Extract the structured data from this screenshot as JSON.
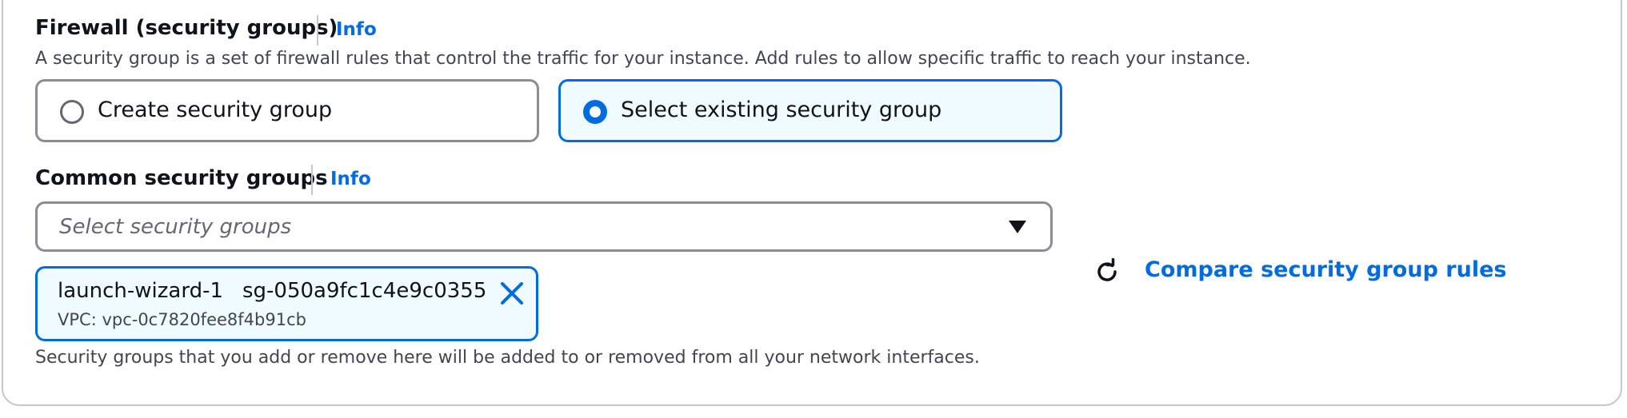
{
  "firewall": {
    "title": "Firewall (security groups)",
    "info_label": "Info",
    "description": "A security group is a set of firewall rules that control the traffic for your instance. Add rules to allow specific traffic to reach your instance.",
    "options": [
      {
        "label": "Create security group",
        "selected": false
      },
      {
        "label": "Select existing security group",
        "selected": true
      }
    ]
  },
  "common_groups": {
    "title": "Common security groups",
    "info_label": "Info",
    "select_placeholder": "Select security groups",
    "selected_token": {
      "name": "launch-wizard-1",
      "id": "sg-050a9fc1c4e9c0355",
      "vpc": "VPC: vpc-0c7820fee8f4b91cb"
    },
    "compare_label": "Compare security group rules",
    "footer_note": "Security groups that you add or remove here will be added to or removed from all your network interfaces."
  },
  "colors": {
    "accent": "#006ce0",
    "selected_bg": "#f0fbff",
    "border": "#8c8c94",
    "text": "#0f141a",
    "secondary_text": "#424650"
  },
  "icons": {
    "dropdown": "caret-down-icon",
    "remove": "close-icon",
    "refresh": "refresh-icon"
  }
}
